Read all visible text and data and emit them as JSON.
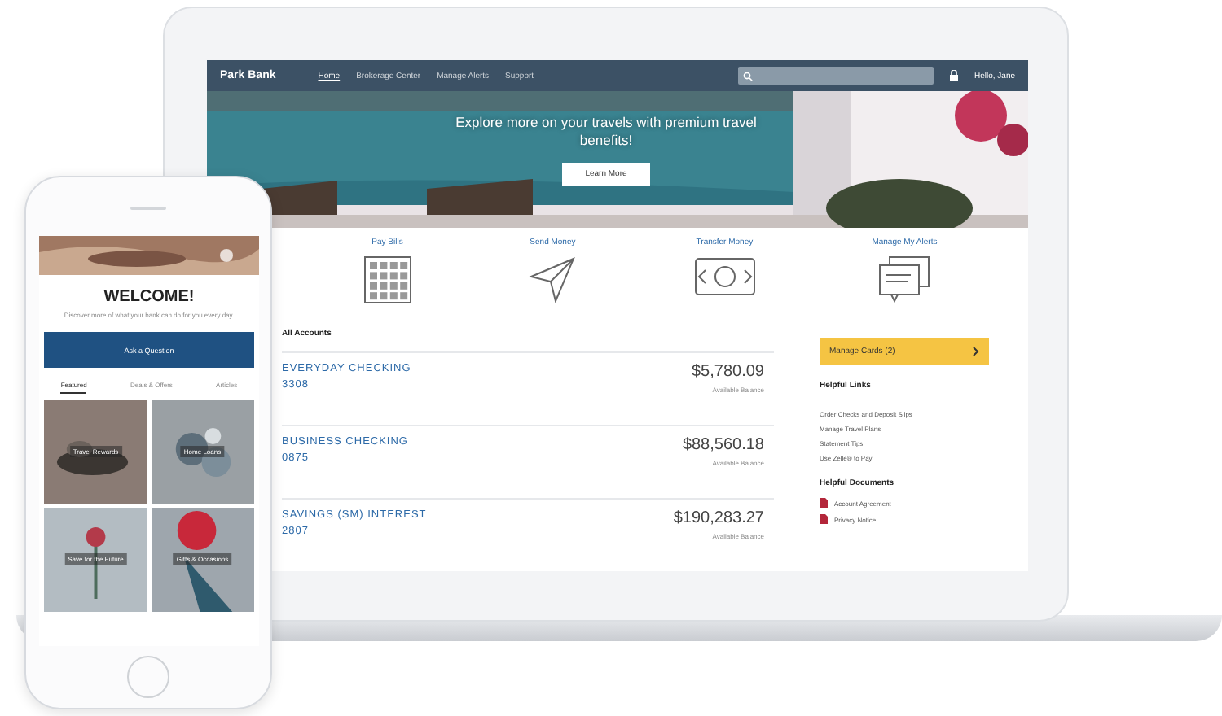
{
  "laptop": {
    "brand": "Park Bank",
    "nav": [
      {
        "label": "Home",
        "selected": true
      },
      {
        "label": "Brokerage Center",
        "selected": false
      },
      {
        "label": "Manage Alerts",
        "selected": false
      },
      {
        "label": "Support",
        "selected": false
      }
    ],
    "user": "Hello, Jane",
    "hero": {
      "headline": "Explore more on your travels with premium travel benefits!",
      "button": "Learn More"
    },
    "actions": [
      {
        "label": "Pay Bills",
        "kind": "bills"
      },
      {
        "label": "Send Money",
        "kind": "send"
      },
      {
        "label": "Transfer Money",
        "kind": "transfer"
      },
      {
        "label": "Manage My Alerts",
        "kind": "alerts"
      }
    ],
    "accounts_title": "All Accounts",
    "accounts": [
      {
        "name": "EVERYDAY CHECKING",
        "number": "3308",
        "balance": "$5,780.09",
        "note": "Available Balance"
      },
      {
        "name": "BUSINESS CHECKING",
        "number": "0875",
        "balance": "$88,560.18",
        "note": "Available Balance"
      },
      {
        "name": "SAVINGS (SM) INTEREST",
        "number": "2807",
        "balance": "$190,283.27",
        "note": "Available Balance"
      }
    ],
    "sidebar": {
      "button": "Manage Cards (2)",
      "links_title": "Helpful Links",
      "links": [
        "Order Checks and Deposit Slips",
        "Manage Travel Plans",
        "Statement Tips",
        "Use Zelle® to Pay"
      ],
      "docs_title": "Helpful Documents",
      "docs": [
        "Account Agreement",
        "Privacy Notice"
      ]
    }
  },
  "phone": {
    "title": "WELCOME!",
    "subtitle": "Discover more of what your bank can do for you every day.",
    "button": "Ask a Question",
    "tabs": [
      {
        "label": "Featured",
        "selected": true
      },
      {
        "label": "Deals & Offers",
        "selected": false
      },
      {
        "label": "Articles",
        "selected": false
      }
    ],
    "tiles": [
      {
        "caption": "Travel Rewards"
      },
      {
        "caption": "Home Loans"
      },
      {
        "caption": "Save for the Future"
      },
      {
        "caption": "Gifts & Occasions"
      }
    ]
  }
}
